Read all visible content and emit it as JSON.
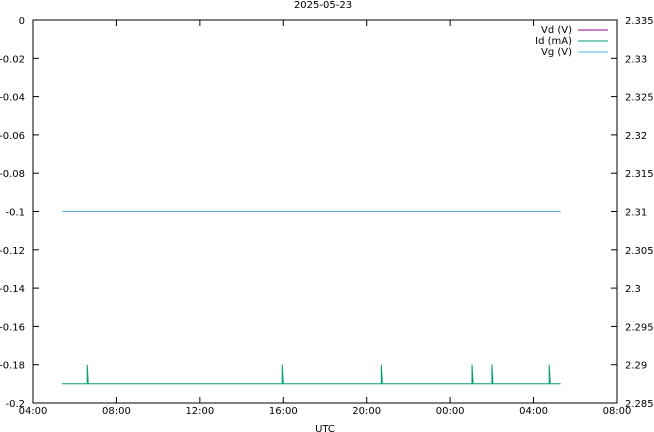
{
  "chart_data": {
    "type": "line",
    "title": "2025-05-23",
    "xlabel": "UTC",
    "ylabel": "",
    "y2label": "",
    "x_ticks": [
      "04:00",
      "08:00",
      "12:00",
      "16:00",
      "20:00",
      "00:00",
      "04:00",
      "08:00"
    ],
    "xlim_hours": [
      4,
      32
    ],
    "ylim": [
      -0.2,
      0
    ],
    "y_ticks": [
      "0",
      "-0.02",
      "-0.04",
      "-0.06",
      "-0.08",
      "-0.1",
      "-0.12",
      "-0.14",
      "-0.16",
      "-0.18",
      "-0.2"
    ],
    "y2lim": [
      2.285,
      2.335
    ],
    "y2_ticks": [
      "2.335",
      "2.33",
      "2.325",
      "2.32",
      "2.315",
      "2.31",
      "2.305",
      "2.3",
      "2.295",
      "2.29",
      "2.285"
    ],
    "legend_position": "top-right",
    "grid": false,
    "series": [
      {
        "name": "Vd (V)",
        "color": "#94008f",
        "axis": "y",
        "points": []
      },
      {
        "name": "Id (mA)",
        "color": "#009e73",
        "axis": "y",
        "points": [
          [
            5.4,
            -0.19
          ],
          [
            6.6,
            -0.19
          ],
          [
            6.6,
            -0.18
          ],
          [
            6.65,
            -0.19
          ],
          [
            15.95,
            -0.19
          ],
          [
            15.95,
            -0.18
          ],
          [
            16.0,
            -0.19
          ],
          [
            20.7,
            -0.19
          ],
          [
            20.7,
            -0.18
          ],
          [
            20.75,
            -0.19
          ],
          [
            25.05,
            -0.19
          ],
          [
            25.05,
            -0.18
          ],
          [
            25.1,
            -0.19
          ],
          [
            26.0,
            -0.19
          ],
          [
            26.0,
            -0.18
          ],
          [
            26.05,
            -0.19
          ],
          [
            28.75,
            -0.19
          ],
          [
            28.75,
            -0.18
          ],
          [
            28.8,
            -0.19
          ],
          [
            29.3,
            -0.19
          ]
        ]
      },
      {
        "name": "Vg (V)",
        "color": "#56b4e9",
        "axis": "y",
        "points": [
          [
            5.4,
            -0.1
          ],
          [
            29.3,
            -0.1
          ]
        ]
      }
    ]
  }
}
